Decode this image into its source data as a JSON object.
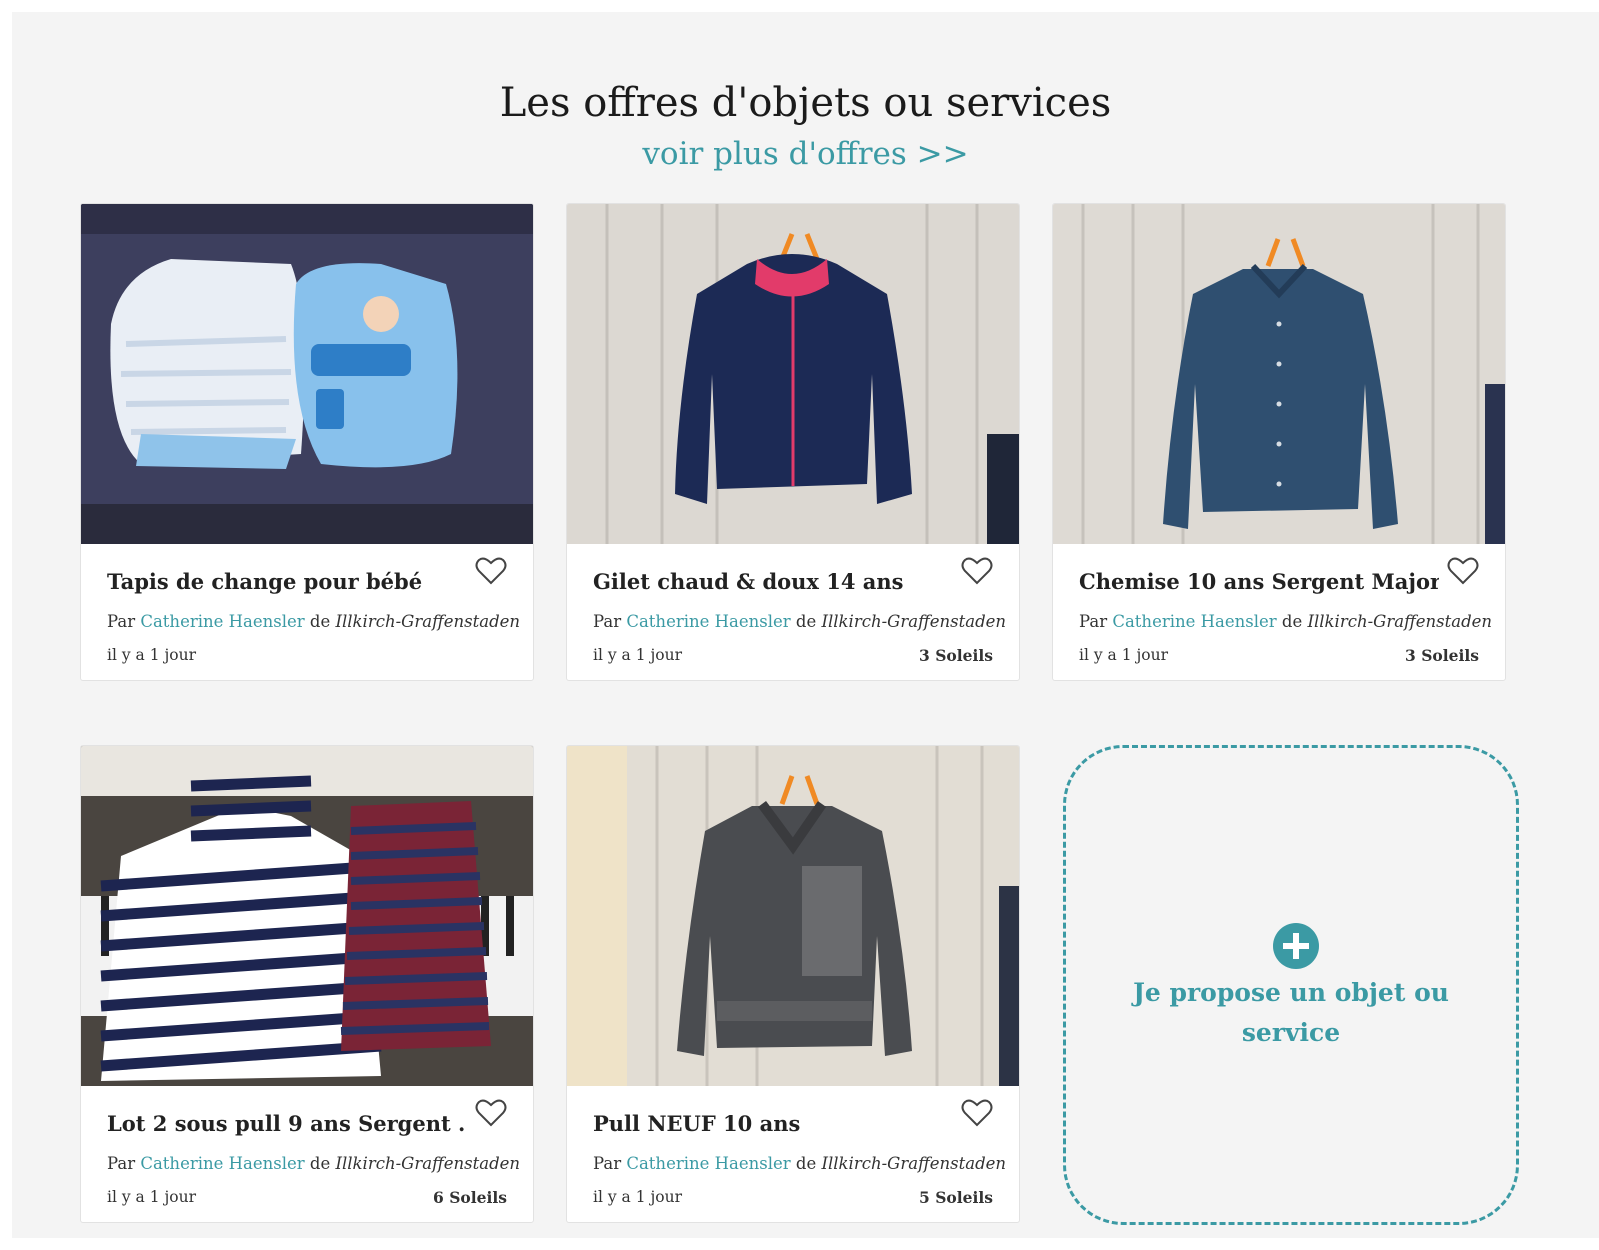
{
  "section": {
    "title": "Les offres d'objets ou services",
    "more_link": "voir plus d'offres >>"
  },
  "offers": [
    {
      "title": "Tapis de change pour bébé",
      "by": "Par",
      "author": "Catherine Haensler",
      "from": "de",
      "city": "Illkirch-Graffenstaden",
      "age": "il y a 1 jour",
      "points": "",
      "image": "diapers-photo"
    },
    {
      "title": "Gilet chaud & doux 14 ans",
      "by": "Par",
      "author": "Catherine Haensler",
      "from": "de",
      "city": "Illkirch-Graffenstaden",
      "age": "il y a 1 jour",
      "points": "3 Soleils",
      "image": "fleece-jacket-photo"
    },
    {
      "title": "Chemise 10 ans Sergent Major",
      "by": "Par",
      "author": "Catherine Haensler",
      "from": "de",
      "city": "Illkirch-Graffenstaden",
      "age": "il y a 1 jour",
      "points": "3 Soleils",
      "image": "denim-shirt-photo"
    },
    {
      "title": "Lot 2 sous pull 9 ans Sergent ..",
      "by": "Par",
      "author": "Catherine Haensler",
      "from": "de",
      "city": "Illkirch-Graffenstaden",
      "age": "il y a 1 jour",
      "points": "6 Soleils",
      "image": "striped-tops-photo"
    },
    {
      "title": "Pull NEUF 10 ans",
      "by": "Par",
      "author": "Catherine Haensler",
      "from": "de",
      "city": "Illkirch-Graffenstaden",
      "age": "il y a 1 jour",
      "points": "5 Soleils",
      "image": "wool-sweater-photo"
    }
  ],
  "propose": {
    "label": "Je propose un objet ou service",
    "icon": "plus-circle-icon"
  },
  "colors": {
    "accent": "#3b9aa4",
    "background": "#f4f4f4",
    "card": "#ffffff"
  }
}
